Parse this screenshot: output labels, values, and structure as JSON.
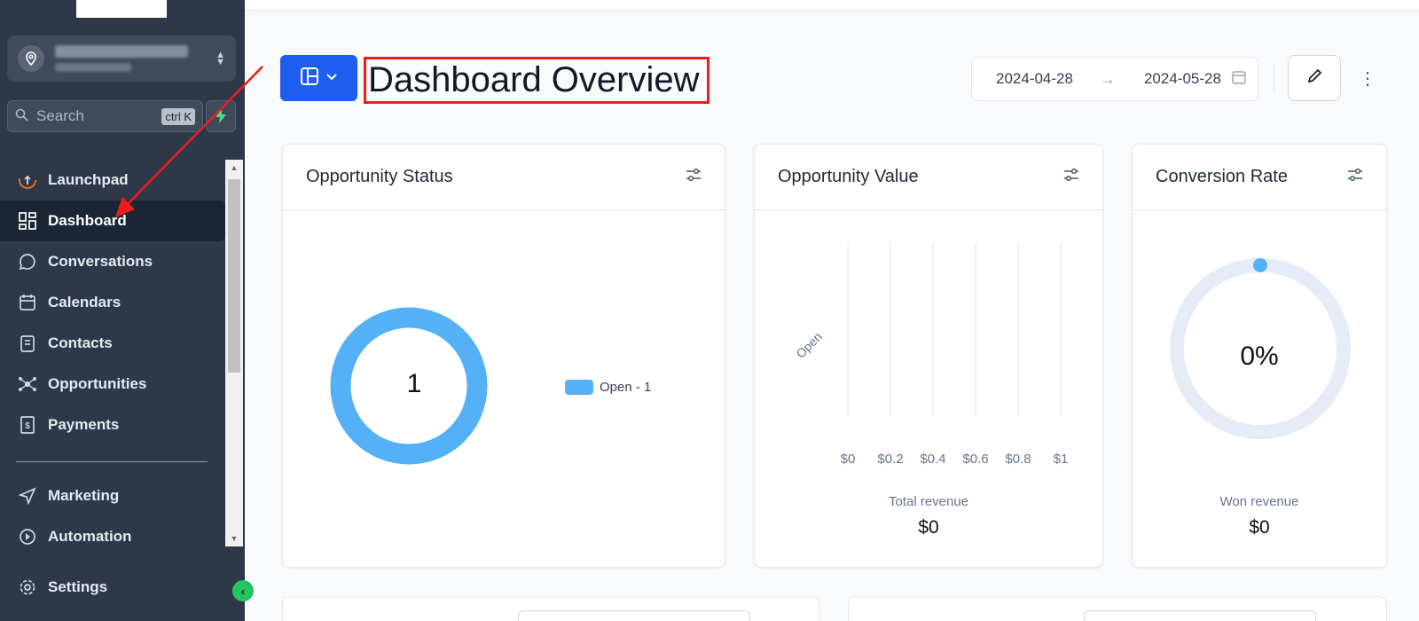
{
  "sidebar": {
    "search_placeholder": "Search",
    "search_shortcut": "ctrl K",
    "items": [
      {
        "label": "Launchpad",
        "icon": "launchpad-icon"
      },
      {
        "label": "Dashboard",
        "icon": "dashboard-icon",
        "active": true
      },
      {
        "label": "Conversations",
        "icon": "chat-icon"
      },
      {
        "label": "Calendars",
        "icon": "calendar-icon"
      },
      {
        "label": "Contacts",
        "icon": "contacts-icon"
      },
      {
        "label": "Opportunities",
        "icon": "opportunities-icon"
      },
      {
        "label": "Payments",
        "icon": "payments-icon"
      },
      {
        "label": "Marketing",
        "icon": "send-icon"
      },
      {
        "label": "Automation",
        "icon": "automation-icon"
      }
    ],
    "settings_label": "Settings"
  },
  "header": {
    "title": "Dashboard Overview",
    "date_from": "2024-04-28",
    "date_to": "2024-05-28"
  },
  "cards": {
    "status": {
      "title": "Opportunity Status",
      "total": "1",
      "legend": "Open - 1"
    },
    "value": {
      "title": "Opportunity Value",
      "category": "Open",
      "ticks": [
        "$0",
        "$0.2",
        "$0.4",
        "$0.6",
        "$0.8",
        "$1"
      ],
      "revenue_label": "Total revenue",
      "revenue_value": "$0"
    },
    "conversion": {
      "title": "Conversion Rate",
      "percent": "0%",
      "revenue_label": "Won revenue",
      "revenue_value": "$0"
    }
  },
  "chart_data": [
    {
      "type": "pie",
      "title": "Opportunity Status",
      "categories": [
        "Open"
      ],
      "values": [
        1
      ]
    },
    {
      "type": "bar",
      "title": "Opportunity Value",
      "categories": [
        "Open"
      ],
      "values": [
        0
      ],
      "xlim": [
        0,
        1
      ]
    },
    {
      "type": "pie",
      "title": "Conversion Rate",
      "categories": [
        "Won"
      ],
      "values": [
        0
      ]
    }
  ],
  "colors": {
    "sidebar_bg": "#2e3848",
    "primary": "#1d5ef0",
    "donut": "#54b0f7",
    "highlight": "#ef1c1c",
    "collapse": "#22c55e"
  }
}
